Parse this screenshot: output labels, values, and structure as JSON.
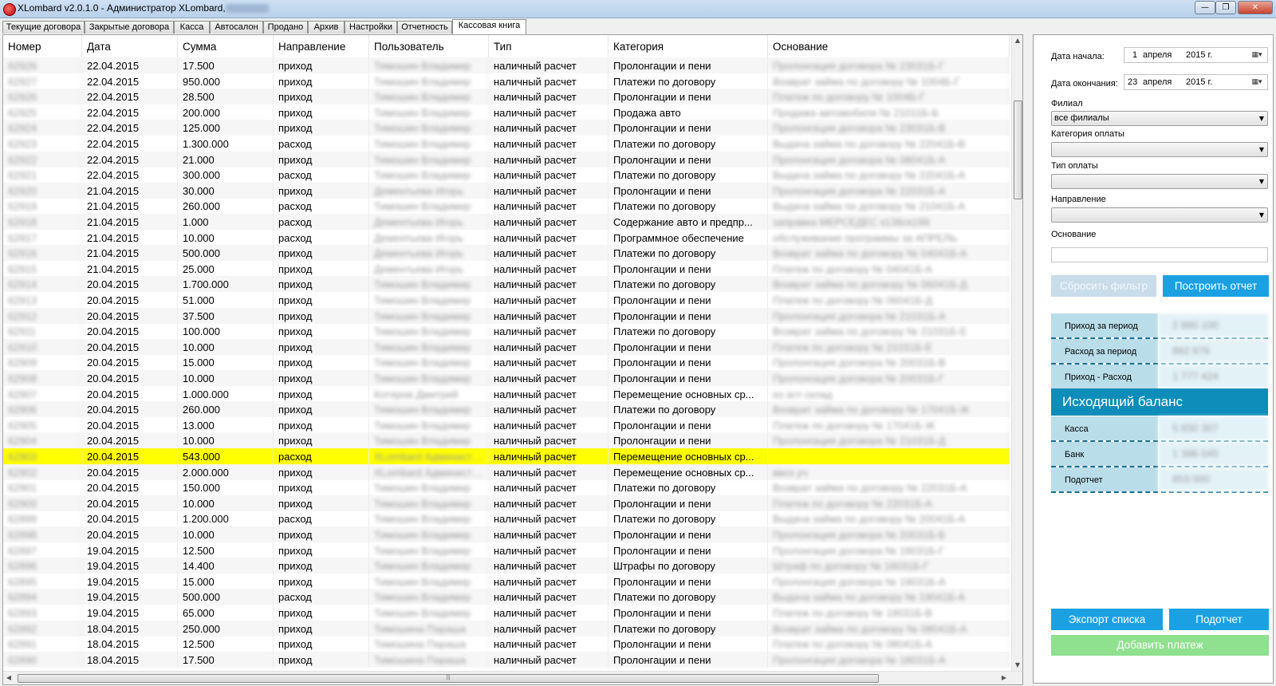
{
  "window": {
    "title": "XLombard v2.0.1.0 - Администратор XLombard,",
    "icons": {
      "app": "xlombard-app-icon",
      "minimize": "minimize-icon",
      "maximize": "maximize-icon",
      "close": "close-icon"
    },
    "minimize_glyph": "—",
    "maximize_glyph": "❐",
    "close_glyph": "✕"
  },
  "tabs": [
    {
      "label": "Текущие договора",
      "active": false
    },
    {
      "label": "Закрытые договора",
      "active": false
    },
    {
      "label": "Касса",
      "active": false
    },
    {
      "label": "Автосалон",
      "active": false
    },
    {
      "label": "Продано",
      "active": false
    },
    {
      "label": "Архив",
      "active": false
    },
    {
      "label": "Настройки",
      "active": false
    },
    {
      "label": "Отчетность",
      "active": false
    },
    {
      "label": "Кассовая книга",
      "active": true
    }
  ],
  "grid": {
    "columns": [
      "Номер",
      "Дата",
      "Сумма",
      "Направление",
      "Пользователь",
      "Тип",
      "Категория",
      "Основание"
    ],
    "rows": [
      {
        "number": "62926",
        "date": "22.04.2015",
        "amount": "17.500",
        "direction": "приход",
        "user": "Тимошин Владимир",
        "type": "наличный расчет",
        "category": "Пролонгации и пени",
        "reason": "Пролонгация договора № 23031Б-Г"
      },
      {
        "number": "62927",
        "date": "22.04.2015",
        "amount": "950.000",
        "direction": "приход",
        "user": "Тимошин Владимир",
        "type": "наличный расчет",
        "category": "Платежи по договору",
        "reason": "Возврат займа по договору № 1004Б-Г"
      },
      {
        "number": "62926",
        "date": "22.04.2015",
        "amount": "28.500",
        "direction": "приход",
        "user": "Тимошин Владимир",
        "type": "наличный расчет",
        "category": "Пролонгации и пени",
        "reason": "Платеж по договору № 1004Б-Г"
      },
      {
        "number": "62925",
        "date": "22.04.2015",
        "amount": "200.000",
        "direction": "приход",
        "user": "Тимошин Владимир",
        "type": "наличный расчет",
        "category": "Продажа авто",
        "reason": "Продажа автомобиля № 21011Б-Б"
      },
      {
        "number": "62924",
        "date": "22.04.2015",
        "amount": "125.000",
        "direction": "приход",
        "user": "Тимошин Владимир",
        "type": "наличный расчет",
        "category": "Пролонгации и пени",
        "reason": "Пролонгация договора № 23031Б-В"
      },
      {
        "number": "62923",
        "date": "22.04.2015",
        "amount": "1.300.000",
        "direction": "расход",
        "user": "Тимошин Владимир",
        "type": "наличный расчет",
        "category": "Платежи по договору",
        "reason": "Выдача займа по договору № 22041Б-В"
      },
      {
        "number": "62922",
        "date": "22.04.2015",
        "amount": "21.000",
        "direction": "приход",
        "user": "Тимошин Владимир",
        "type": "наличный расчет",
        "category": "Пролонгации и пени",
        "reason": "Пролонгация договора № 08041Б-А"
      },
      {
        "number": "62921",
        "date": "22.04.2015",
        "amount": "300.000",
        "direction": "расход",
        "user": "Тимошин Владимир",
        "type": "наличный расчет",
        "category": "Платежи по договору",
        "reason": "Выдача займа по договору № 22041Б-А"
      },
      {
        "number": "62920",
        "date": "21.04.2015",
        "amount": "30.000",
        "direction": "приход",
        "user": "Дементьева Игорь",
        "type": "наличный расчет",
        "category": "Пролонгации и пени",
        "reason": "Пролонгация договора № 22031Б-А"
      },
      {
        "number": "62919",
        "date": "21.04.2015",
        "amount": "260.000",
        "direction": "расход",
        "user": "Тимошин Владимир",
        "type": "наличный расчет",
        "category": "Платежи по договору",
        "reason": "Выдача займа по договору № 21041Б-А"
      },
      {
        "number": "62918",
        "date": "21.04.2015",
        "amount": "1.000",
        "direction": "расход",
        "user": "Дементьева Игорь",
        "type": "наличный расчет",
        "category": "Содержание авто и предпр...",
        "reason": "заправка МЕРСЕДЕС к136ск199"
      },
      {
        "number": "62917",
        "date": "21.04.2015",
        "amount": "10.000",
        "direction": "расход",
        "user": "Дементьева Игорь",
        "type": "наличный расчет",
        "category": "Программное обеспечение",
        "reason": "обслуживание программы за АПРЕЛЬ"
      },
      {
        "number": "62916",
        "date": "21.04.2015",
        "amount": "500.000",
        "direction": "приход",
        "user": "Дементьева Игорь",
        "type": "наличный расчет",
        "category": "Платежи по договору",
        "reason": "Возврат займа по договору № 04041Б-А"
      },
      {
        "number": "62915",
        "date": "21.04.2015",
        "amount": "25.000",
        "direction": "приход",
        "user": "Дементьева Игорь",
        "type": "наличный расчет",
        "category": "Пролонгации и пени",
        "reason": "Платеж по договору № 04041Б-А"
      },
      {
        "number": "62914",
        "date": "20.04.2015",
        "amount": "1.700.000",
        "direction": "приход",
        "user": "Тимошин Владимир",
        "type": "наличный расчет",
        "category": "Платежи по договору",
        "reason": "Возврат займа по договору № 06041Б-Д"
      },
      {
        "number": "62913",
        "date": "20.04.2015",
        "amount": "51.000",
        "direction": "приход",
        "user": "Тимошин Владимир",
        "type": "наличный расчет",
        "category": "Пролонгации и пени",
        "reason": "Платеж по договору № 06041Б-Д"
      },
      {
        "number": "62912",
        "date": "20.04.2015",
        "amount": "37.500",
        "direction": "приход",
        "user": "Тимошин Владимир",
        "type": "наличный расчет",
        "category": "Пролонгации и пени",
        "reason": "Пролонгация договора № 21031Б-А"
      },
      {
        "number": "62911",
        "date": "20.04.2015",
        "amount": "100.000",
        "direction": "приход",
        "user": "Тимошин Владимир",
        "type": "наличный расчет",
        "category": "Платежи по договору",
        "reason": "Возврат займа по договору № 21031Б-Е"
      },
      {
        "number": "62910",
        "date": "20.04.2015",
        "amount": "10.000",
        "direction": "приход",
        "user": "Тимошин Владимир",
        "type": "наличный расчет",
        "category": "Пролонгации и пени",
        "reason": "Платеж по договору № 21031Б-Е"
      },
      {
        "number": "62909",
        "date": "20.04.2015",
        "amount": "15.000",
        "direction": "приход",
        "user": "Тимошин Владимир",
        "type": "наличный расчет",
        "category": "Пролонгации и пени",
        "reason": "Пролонгация договора № 20031Б-В"
      },
      {
        "number": "62908",
        "date": "20.04.2015",
        "amount": "10.000",
        "direction": "приход",
        "user": "Тимошин Владимир",
        "type": "наличный расчет",
        "category": "Пролонгации и пени",
        "reason": "Пролонгация договора № 20031Б-Г"
      },
      {
        "number": "62907",
        "date": "20.04.2015",
        "amount": "1.000.000",
        "direction": "приход",
        "user": "Котяров Дмитрий",
        "type": "наличный расчет",
        "category": "Перемещение основных ср...",
        "reason": "из агл склад"
      },
      {
        "number": "62906",
        "date": "20.04.2015",
        "amount": "260.000",
        "direction": "приход",
        "user": "Тимошин Владимир",
        "type": "наличный расчет",
        "category": "Платежи по договору",
        "reason": "Возврат займа по договору № 17041Б-Ж"
      },
      {
        "number": "62905",
        "date": "20.04.2015",
        "amount": "13.000",
        "direction": "приход",
        "user": "Тимошин Владимир",
        "type": "наличный расчет",
        "category": "Пролонгации и пени",
        "reason": "Платеж по договору № 17041Б-Ж"
      },
      {
        "number": "62904",
        "date": "20.04.2015",
        "amount": "10.000",
        "direction": "приход",
        "user": "Тимошин Владимир",
        "type": "наличный расчет",
        "category": "Пролонгации и пени",
        "reason": "Пролонгация договора № 21031Б-Д"
      },
      {
        "number": "62903",
        "date": "20.04.2015",
        "amount": "543.000",
        "direction": "расход",
        "user": "XLombard Администратор",
        "type": "наличный расчет",
        "category": "Перемещение основных ср...",
        "reason": "",
        "selected": true
      },
      {
        "number": "62902",
        "date": "20.04.2015",
        "amount": "2.000.000",
        "direction": "приход",
        "user": "XLombard Администратор",
        "type": "наличный расчет",
        "category": "Перемещение основных ср...",
        "reason": "ввоз уч"
      },
      {
        "number": "62901",
        "date": "20.04.2015",
        "amount": "150.000",
        "direction": "приход",
        "user": "Тимошин Владимир",
        "type": "наличный расчет",
        "category": "Платежи по договору",
        "reason": "Возврат займа по договору № 22031Б-А"
      },
      {
        "number": "62900",
        "date": "20.04.2015",
        "amount": "10.000",
        "direction": "приход",
        "user": "Тимошин Владимир",
        "type": "наличный расчет",
        "category": "Пролонгации и пени",
        "reason": "Платеж по договору № 22031Б-А"
      },
      {
        "number": "62899",
        "date": "20.04.2015",
        "amount": "1.200.000",
        "direction": "расход",
        "user": "Тимошин Владимир",
        "type": "наличный расчет",
        "category": "Платежи по договору",
        "reason": "Выдача займа по договору № 20041Б-А"
      },
      {
        "number": "62898",
        "date": "20.04.2015",
        "amount": "10.000",
        "direction": "приход",
        "user": "Тимошин Владимир",
        "type": "наличный расчет",
        "category": "Пролонгации и пени",
        "reason": "Пролонгация договора № 20031Б-Б"
      },
      {
        "number": "62897",
        "date": "19.04.2015",
        "amount": "12.500",
        "direction": "приход",
        "user": "Тимошин Владимир",
        "type": "наличный расчет",
        "category": "Пролонгации и пени",
        "reason": "Пролонгация договора № 18031Б-Г"
      },
      {
        "number": "62896",
        "date": "19.04.2015",
        "amount": "14.400",
        "direction": "приход",
        "user": "Тимошин Владимир",
        "type": "наличный расчет",
        "category": "Штрафы по договору",
        "reason": "Штраф по договору № 16031Б-Г"
      },
      {
        "number": "62895",
        "date": "19.04.2015",
        "amount": "15.000",
        "direction": "приход",
        "user": "Тимошин Владимир",
        "type": "наличный расчет",
        "category": "Пролонгации и пени",
        "reason": "Пролонгация договора № 19031Б-А"
      },
      {
        "number": "62894",
        "date": "19.04.2015",
        "amount": "500.000",
        "direction": "расход",
        "user": "Тимошин Владимир",
        "type": "наличный расчет",
        "category": "Платежи по договору",
        "reason": "Выдача займа по договору № 19041Б-А"
      },
      {
        "number": "62893",
        "date": "19.04.2015",
        "amount": "65.000",
        "direction": "приход",
        "user": "Тимошин Владимир",
        "type": "наличный расчет",
        "category": "Пролонгации и пени",
        "reason": "Платеж по договору № 19031Б-В"
      },
      {
        "number": "62892",
        "date": "18.04.2015",
        "amount": "250.000",
        "direction": "приход",
        "user": "Тимошина Параша",
        "type": "наличный расчет",
        "category": "Платежи по договору",
        "reason": "Возврат займа по договору № 08041Б-А"
      },
      {
        "number": "62891",
        "date": "18.04.2015",
        "amount": "12.500",
        "direction": "приход",
        "user": "Тимошина Параша",
        "type": "наличный расчет",
        "category": "Пролонгации и пени",
        "reason": "Платеж по договору № 08041Б-А"
      },
      {
        "number": "62890",
        "date": "18.04.2015",
        "amount": "17.500",
        "direction": "приход",
        "user": "Тимошина Параша",
        "type": "наличный расчет",
        "category": "Пролонгации и пени",
        "reason": "Пролонгация договора № 18031Б-А"
      }
    ],
    "scroll_glyphs": {
      "up": "▲",
      "down": "▼",
      "left": "◀",
      "right": "▶",
      "grip": "|||"
    },
    "colors": {
      "selected": "#ffff00",
      "alt_row": "#f6f6f6"
    }
  },
  "filters": {
    "start_date_label": "Дата начала:",
    "start_date": {
      "day": "1",
      "month": "апреля",
      "year": "2015 г."
    },
    "end_date_label": "Дата окончания:",
    "end_date": {
      "day": "23",
      "month": "апреля",
      "year": "2015 г."
    },
    "calendar_glyph": "▦▾",
    "branch_label": "Филиал",
    "branch_value": "все филиалы",
    "payment_category_label": "Категория оплаты",
    "payment_category_value": "",
    "payment_type_label": "Тип оплаты",
    "payment_type_value": "",
    "direction_label": "Направление",
    "direction_value": "",
    "reason_label": "Основание",
    "reason_value": "",
    "combo_arrow": "▼",
    "reset_button": "Сбросить фильтр",
    "build_report_button": "Построить отчет"
  },
  "summary": {
    "income_label": "Приход за период",
    "income_value": "2 880 100",
    "expense_label": "Расход за период",
    "expense_value": "862 676",
    "net_label": "Приход - Расход",
    "net_value": "1 777 424",
    "balance_title": "Исходящий баланс",
    "cash_label": "Касса",
    "cash_value": "5 650 307",
    "bank_label": "Банк",
    "bank_value": "1 396 045",
    "subreport_label": "Подотчет",
    "subreport_value": "853 000"
  },
  "actions": {
    "export_list": "Экспорт списка",
    "subreport": "Подотчет",
    "add_payment": "Добавить платеж"
  },
  "colors": {
    "accent": "#1ba1e2",
    "balance_header": "#0d8db9",
    "add_payment": "#8fe08f",
    "summary_label_bg": "#b9dde9"
  }
}
